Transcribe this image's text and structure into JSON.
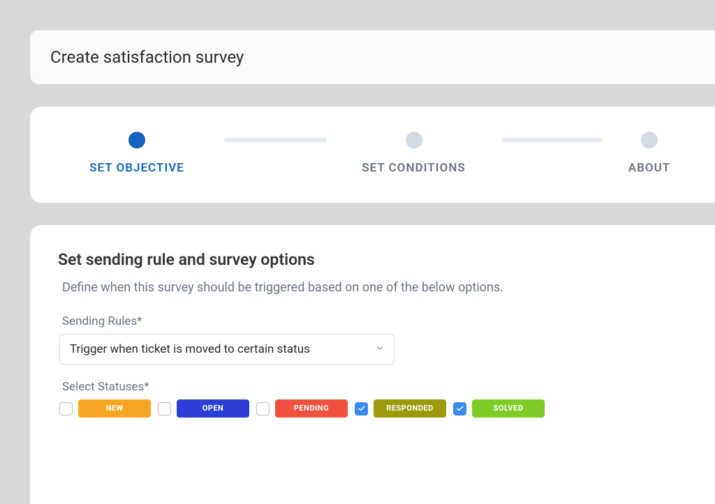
{
  "header": {
    "title": "Create satisfaction survey"
  },
  "stepper": {
    "steps": [
      {
        "label": "SET OBJECTIVE",
        "active": true
      },
      {
        "label": "SET CONDITIONS",
        "active": false
      },
      {
        "label": "ABOUT",
        "active": false
      }
    ]
  },
  "form": {
    "section_title": "Set sending rule and survey options",
    "section_desc": "Define when this survey should be triggered based on one of the below options.",
    "sending_rules": {
      "label": "Sending Rules*",
      "selected": "Trigger when ticket is moved to certain status"
    },
    "statuses": {
      "label": "Select Statuses*",
      "items": [
        {
          "label": "NEW",
          "checked": false,
          "color": "#f5a623"
        },
        {
          "label": "OPEN",
          "checked": false,
          "color": "#2b3fd6"
        },
        {
          "label": "PENDING",
          "checked": false,
          "color": "#f0513c"
        },
        {
          "label": "RESPONDED",
          "checked": true,
          "color": "#9b9b0d"
        },
        {
          "label": "SOLVED",
          "checked": true,
          "color": "#7fcc29"
        }
      ]
    }
  }
}
